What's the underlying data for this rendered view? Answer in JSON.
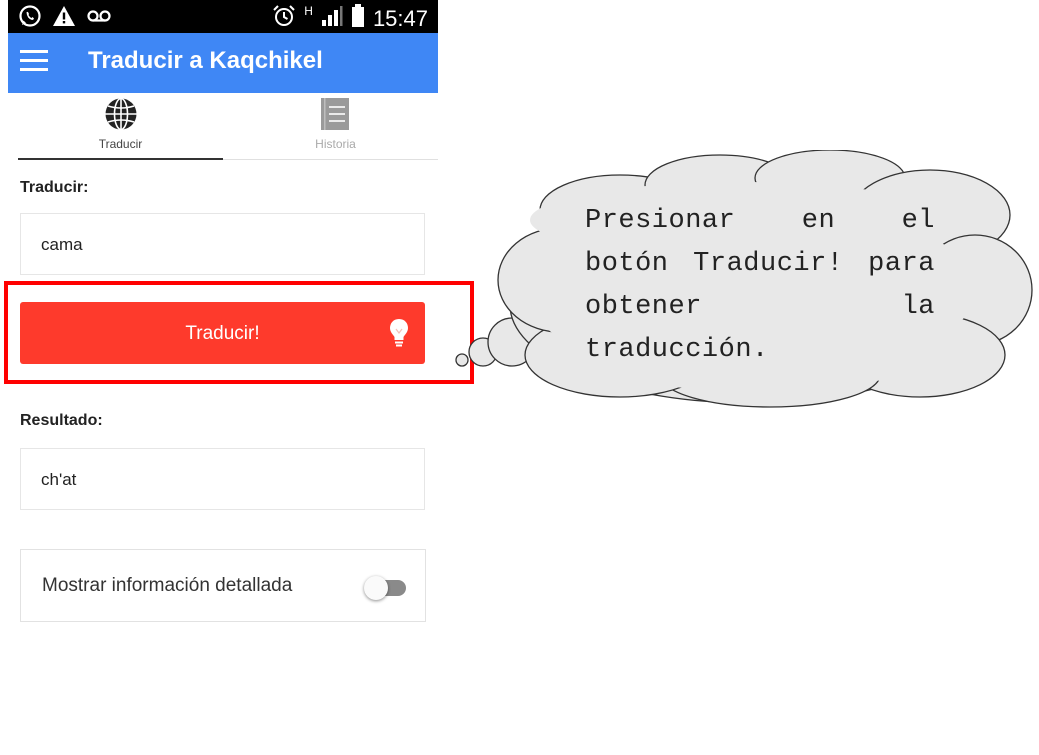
{
  "status_bar": {
    "time": "15:47",
    "network_type": "H",
    "icons": [
      "whatsapp-icon",
      "warning-icon",
      "voicemail-icon",
      "alarm-icon",
      "signal-icon",
      "battery-icon"
    ]
  },
  "app_bar": {
    "title": "Traducir a Kaqchikel",
    "color": "#3f87f5"
  },
  "tabs": [
    {
      "label": "Traducir",
      "icon": "globe-icon",
      "active": true
    },
    {
      "label": "Historia",
      "icon": "document-icon",
      "active": false
    }
  ],
  "form": {
    "input_label": "Traducir:",
    "input_value": "cama",
    "button_label": "Traducir!",
    "button_icon": "lightbulb-icon",
    "button_color": "#fe3a2c",
    "result_label": "Resultado:",
    "result_value": "ch'at",
    "toggle_label": "Mostrar información detallada",
    "toggle_on": false
  },
  "callout": {
    "text": "Presionar en el botón Traducir! para obtener la traducción."
  },
  "highlight_color": "#ff0000"
}
